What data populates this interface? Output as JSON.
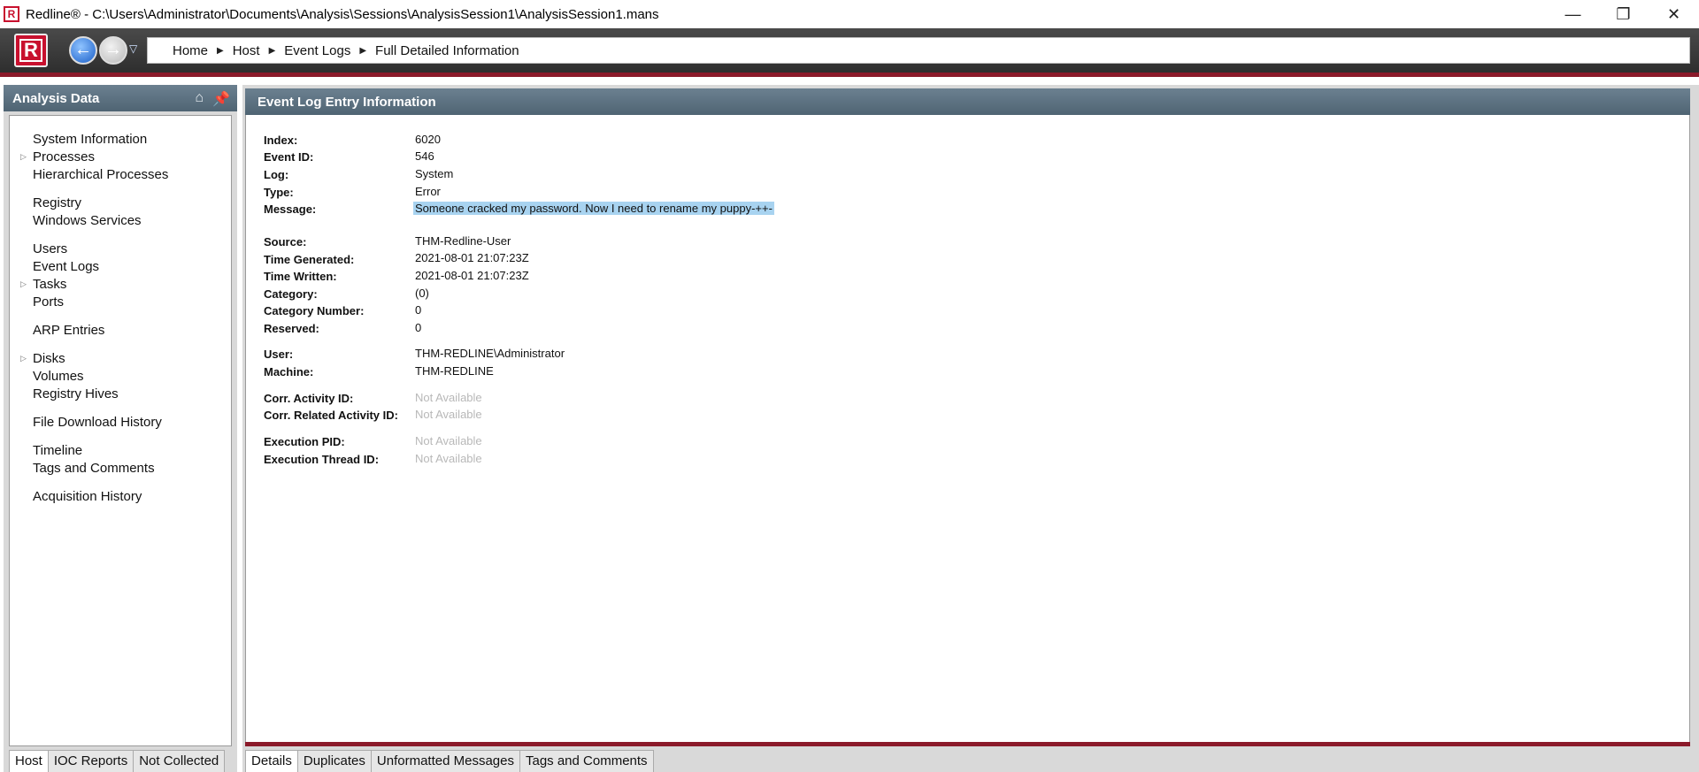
{
  "window": {
    "title": "Redline® - C:\\Users\\Administrator\\Documents\\Analysis\\Sessions\\AnalysisSession1\\AnalysisSession1.mans",
    "minimize": "—",
    "restore": "❐",
    "close": "✕"
  },
  "toolbar": {
    "logo": "R",
    "back": "←",
    "forward": "→",
    "dropdown": "▽",
    "breadcrumb": [
      "Home",
      "Host",
      "Event Logs",
      "Full Detailed Information"
    ]
  },
  "sidebar": {
    "title": "Analysis Data",
    "items": [
      {
        "label": "System Information",
        "expandable": false
      },
      {
        "label": "Processes",
        "expandable": true
      },
      {
        "label": "Hierarchical Processes",
        "expandable": false
      },
      {
        "label": "Registry",
        "expandable": false
      },
      {
        "label": "Windows Services",
        "expandable": false
      },
      {
        "label": "Users",
        "expandable": false
      },
      {
        "label": "Event Logs",
        "expandable": false
      },
      {
        "label": "Tasks",
        "expandable": true
      },
      {
        "label": "Ports",
        "expandable": false
      },
      {
        "label": "ARP Entries",
        "expandable": false
      },
      {
        "label": "Disks",
        "expandable": true
      },
      {
        "label": "Volumes",
        "expandable": false
      },
      {
        "label": "Registry Hives",
        "expandable": false
      },
      {
        "label": "File Download History",
        "expandable": false
      },
      {
        "label": "Timeline",
        "expandable": false
      },
      {
        "label": "Tags and Comments",
        "expandable": false
      },
      {
        "label": "Acquisition History",
        "expandable": false
      }
    ],
    "tabs": [
      "Host",
      "IOC Reports",
      "Not Collected"
    ],
    "active_tab": "Host"
  },
  "main": {
    "title": "Event Log Entry Information",
    "fields": [
      {
        "label": "Index:",
        "value": "6020"
      },
      {
        "label": "Event ID:",
        "value": "546"
      },
      {
        "label": "Log:",
        "value": "System"
      },
      {
        "label": "Type:",
        "value": "Error"
      },
      {
        "label": "Message:",
        "value": "Someone cracked my password. Now I need to rename my puppy-++-"
      },
      {
        "label": "Source:",
        "value": "THM-Redline-User"
      },
      {
        "label": "Time Generated:",
        "value": "2021-08-01 21:07:23Z"
      },
      {
        "label": "Time Written:",
        "value": "2021-08-01 21:07:23Z"
      },
      {
        "label": "Category:",
        "value": "(0)"
      },
      {
        "label": "Category Number:",
        "value": "0"
      },
      {
        "label": "Reserved:",
        "value": "0"
      },
      {
        "label": "User:",
        "value": "THM-REDLINE\\Administrator"
      },
      {
        "label": "Machine:",
        "value": "THM-REDLINE"
      },
      {
        "label": "Corr. Activity ID:",
        "value": "Not Available"
      },
      {
        "label": "Corr. Related Activity ID:",
        "value": "Not Available"
      },
      {
        "label": "Execution PID:",
        "value": "Not Available"
      },
      {
        "label": "Execution Thread ID:",
        "value": "Not Available"
      }
    ],
    "tabs": [
      "Details",
      "Duplicates",
      "Unformatted Messages",
      "Tags and Comments"
    ],
    "active_tab": "Details"
  },
  "colors": {
    "accent_red": "#c8102e",
    "header_bar": "#5d7282",
    "selection": "#a8d3f0"
  }
}
